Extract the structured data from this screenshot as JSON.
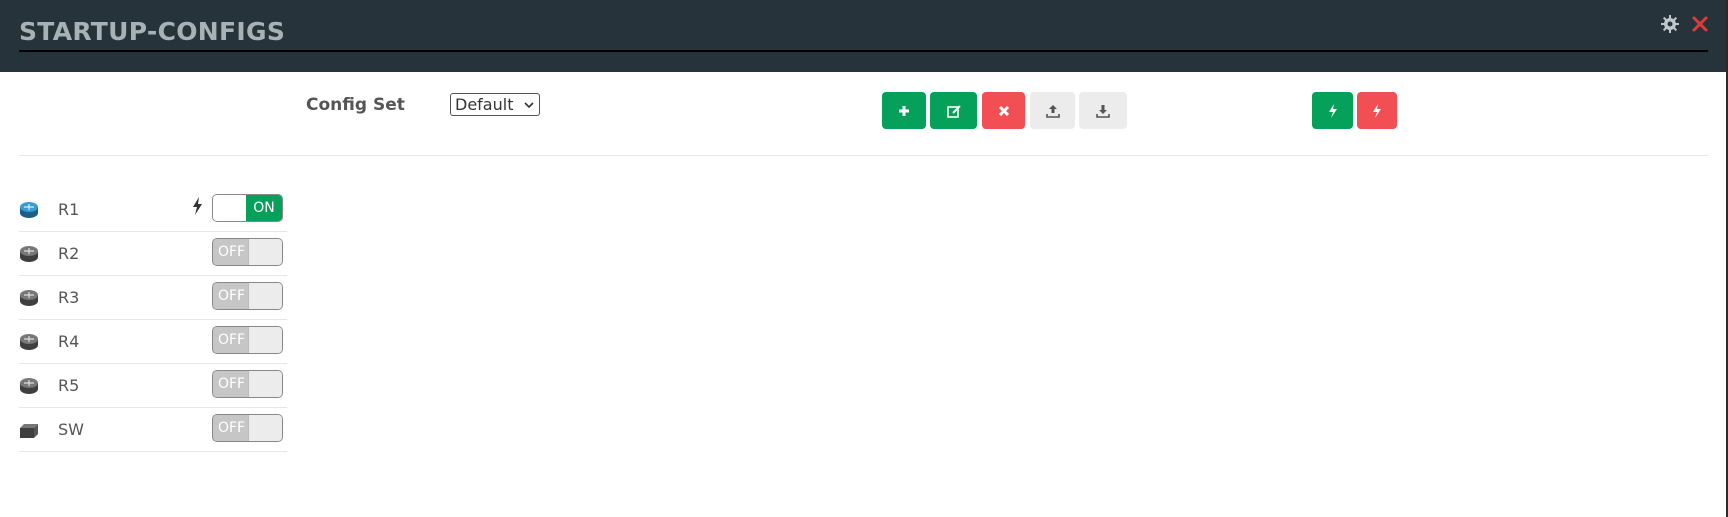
{
  "header": {
    "title": "STARTUP-CONFIGS",
    "icons": [
      "gear-icon",
      "close-icon"
    ],
    "close_color": "#e03a3a"
  },
  "toolbar": {
    "config_set_label": "Config Set",
    "config_set_value": "Default",
    "buttons": [
      {
        "name": "add-config-button",
        "icon": "plus-icon",
        "color": "#05a05a"
      },
      {
        "name": "edit-config-button",
        "icon": "edit-icon",
        "color": "#05a05a"
      },
      {
        "name": "delete-config-button",
        "icon": "x-icon",
        "color": "#f24f55"
      },
      {
        "name": "upload-config-button",
        "icon": "upload-icon",
        "color": "#ececec"
      },
      {
        "name": "download-config-button",
        "icon": "download-icon",
        "color": "#ececec"
      },
      {
        "name": "enable-all-button",
        "icon": "flash-icon",
        "color": "#05a05a"
      },
      {
        "name": "disable-all-button",
        "icon": "flash-icon",
        "color": "#f24f55"
      }
    ]
  },
  "nodes": [
    {
      "name": "R1",
      "type": "router",
      "active": true,
      "state_label": "ON",
      "has_flash": true
    },
    {
      "name": "R2",
      "type": "router",
      "active": false,
      "state_label": "OFF"
    },
    {
      "name": "R3",
      "type": "router",
      "active": false,
      "state_label": "OFF"
    },
    {
      "name": "R4",
      "type": "router",
      "active": false,
      "state_label": "OFF"
    },
    {
      "name": "R5",
      "type": "router",
      "active": false,
      "state_label": "OFF"
    },
    {
      "name": "SW",
      "type": "switch",
      "active": false,
      "state_label": "OFF"
    }
  ]
}
